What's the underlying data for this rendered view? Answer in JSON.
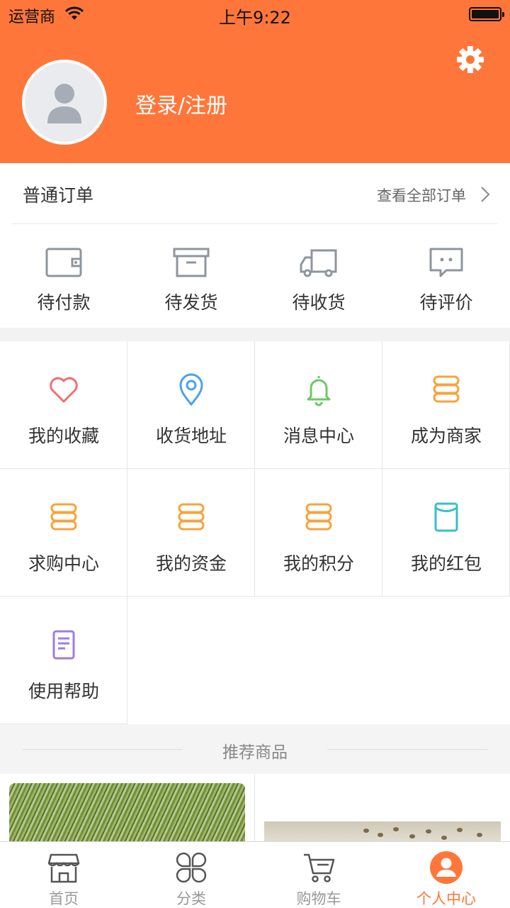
{
  "status_bar": {
    "carrier": "运营商",
    "time": "上午9:22"
  },
  "profile": {
    "login_label": "登录/注册"
  },
  "orders": {
    "title": "普通订单",
    "view_all": "查看全部订单",
    "items": [
      {
        "label": "待付款",
        "icon": "wallet-icon"
      },
      {
        "label": "待发货",
        "icon": "box-icon"
      },
      {
        "label": "待收货",
        "icon": "truck-icon"
      },
      {
        "label": "待评价",
        "icon": "comment-icon"
      }
    ]
  },
  "services": [
    {
      "label": "我的收藏",
      "icon": "heart-icon",
      "color": "#f06e73"
    },
    {
      "label": "收货地址",
      "icon": "location-pin-icon",
      "color": "#4aa3e8"
    },
    {
      "label": "消息中心",
      "icon": "bell-icon",
      "color": "#6cc963"
    },
    {
      "label": "成为商家",
      "icon": "coin-stack-icon",
      "color": "#f7a33b"
    },
    {
      "label": "求购中心",
      "icon": "coin-stack-icon",
      "color": "#f7a33b"
    },
    {
      "label": "我的资金",
      "icon": "coin-stack-icon",
      "color": "#f7a33b"
    },
    {
      "label": "我的积分",
      "icon": "coin-stack-icon",
      "color": "#f7a33b"
    },
    {
      "label": "我的红包",
      "icon": "red-packet-icon",
      "color": "#36bfc8"
    },
    {
      "label": "使用帮助",
      "icon": "document-icon",
      "color": "#9c7ee3"
    }
  ],
  "recommend": {
    "title": "推荐商品"
  },
  "tabs": [
    {
      "label": "首页",
      "icon": "shop-icon"
    },
    {
      "label": "分类",
      "icon": "grid-category-icon"
    },
    {
      "label": "购物车",
      "icon": "cart-icon"
    },
    {
      "label": "个人中心",
      "icon": "user-center-icon",
      "active": true
    }
  ],
  "colors": {
    "brand": "#ff763a",
    "icon_gray": "#8f959c"
  }
}
